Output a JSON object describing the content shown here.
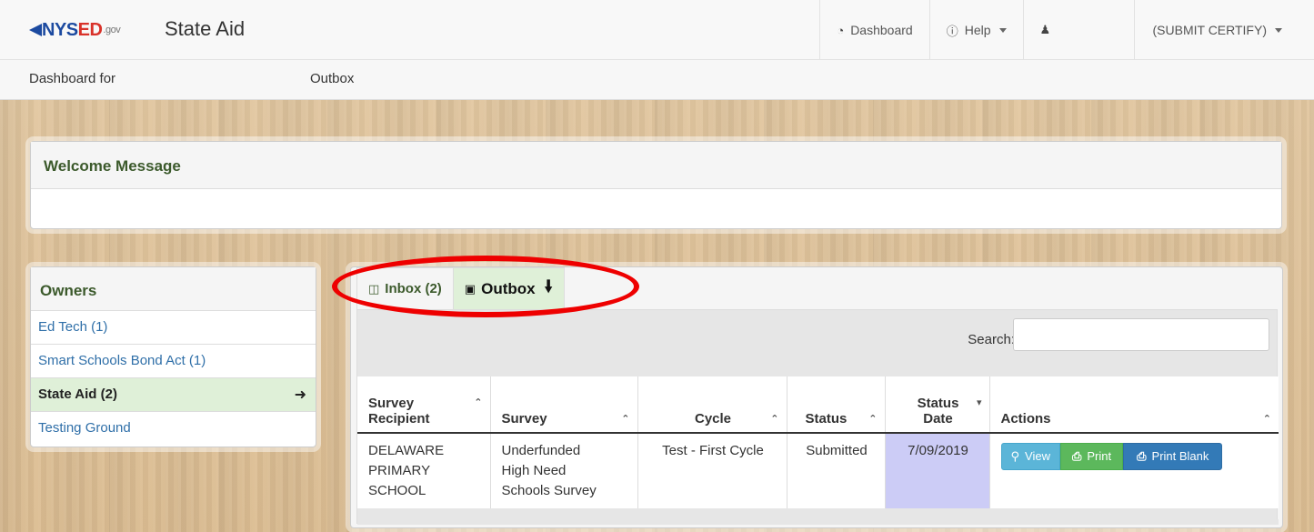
{
  "header": {
    "brand_main": "NYS",
    "brand_ed": "ED",
    "brand_gov": ".gov",
    "app_title": "State Aid",
    "nav": {
      "dashboard": "Dashboard",
      "help": "Help",
      "role": "(SUBMIT CERTIFY)"
    }
  },
  "subbar": {
    "dashboard_for": "Dashboard for",
    "outbox": "Outbox"
  },
  "welcome": {
    "title": "Welcome Message"
  },
  "owners": {
    "title": "Owners",
    "items": [
      {
        "label": "Ed Tech (1)"
      },
      {
        "label": "Smart Schools Bond Act (1)"
      },
      {
        "label": "State Aid (2)"
      },
      {
        "label": "Testing Ground"
      }
    ]
  },
  "tabs": {
    "inbox": "Inbox (2)",
    "outbox": "Outbox"
  },
  "search": {
    "label": "Search:",
    "value": ""
  },
  "table": {
    "headers": {
      "recipient_1": "Survey",
      "recipient_2": "Recipient",
      "survey": "Survey",
      "cycle": "Cycle",
      "status": "Status",
      "date_1": "Status",
      "date_2": "Date",
      "actions": "Actions"
    },
    "rows": [
      {
        "recipient_1": "DELAWARE",
        "recipient_2": "PRIMARY",
        "recipient_3": "SCHOOL",
        "survey_1": "Underfunded",
        "survey_2": "High Need",
        "survey_3": "Schools Survey",
        "cycle": "Test - First Cycle",
        "status": "Submitted",
        "date": "7/09/2019"
      }
    ],
    "actions": {
      "view": "View",
      "print": "Print",
      "print_blank": "Print Blank"
    }
  },
  "colors": {
    "brand_blue": "#1c4aa0",
    "brand_red": "#d9322a",
    "active_green": "#dff0d8",
    "link_blue": "#2f6fa8",
    "highlight_red": "#e00"
  }
}
